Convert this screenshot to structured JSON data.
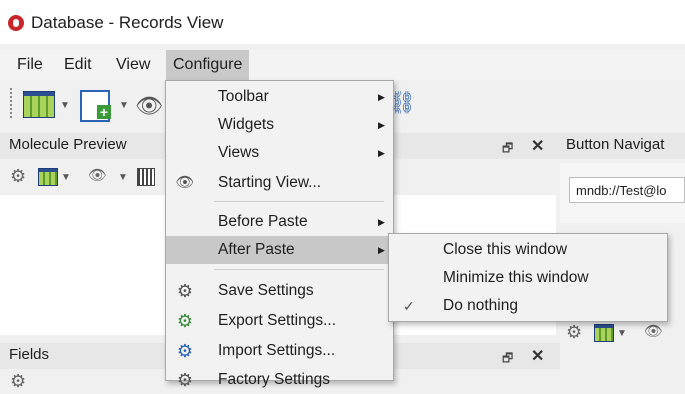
{
  "window": {
    "title": "Database - Records View"
  },
  "menubar": {
    "items": [
      "File",
      "Edit",
      "View",
      "Configure"
    ]
  },
  "panels": {
    "molecule_preview": {
      "title": "Molecule Preview"
    },
    "button_navigator": {
      "title": "Button Navigat",
      "url": "mndb://Test@lo"
    },
    "fields": {
      "title": "Fields"
    }
  },
  "configure_menu": {
    "items": [
      {
        "label": "Toolbar",
        "submenu": true,
        "icon": ""
      },
      {
        "label": "Widgets",
        "submenu": true,
        "icon": ""
      },
      {
        "label": "Views",
        "submenu": true,
        "icon": ""
      },
      {
        "label": "Starting View...",
        "submenu": false,
        "icon": "eye-icon"
      },
      {
        "label": "Before Paste",
        "submenu": true,
        "icon": ""
      },
      {
        "label": "After Paste",
        "submenu": true,
        "icon": "",
        "highlighted": true
      },
      {
        "label": "Save Settings",
        "submenu": false,
        "icon": "gear-save-icon"
      },
      {
        "label": "Export Settings...",
        "submenu": false,
        "icon": "gear-export-icon"
      },
      {
        "label": "Import Settings...",
        "submenu": false,
        "icon": "gear-import-icon"
      },
      {
        "label": "Factory Settings",
        "submenu": false,
        "icon": "gear-reset-icon"
      }
    ]
  },
  "after_paste_submenu": {
    "items": [
      {
        "label": "Close this window",
        "checked": false
      },
      {
        "label": "Minimize this window",
        "checked": false
      },
      {
        "label": "Do nothing",
        "checked": true
      }
    ]
  },
  "icons": {
    "pin": "🗗",
    "close": "✕",
    "submenu_arrow": "▶",
    "check": "✓",
    "gear": "⚙",
    "eye": "👁"
  },
  "colors": {
    "highlight": "#c8c8c8",
    "logo": "#c8262a"
  }
}
